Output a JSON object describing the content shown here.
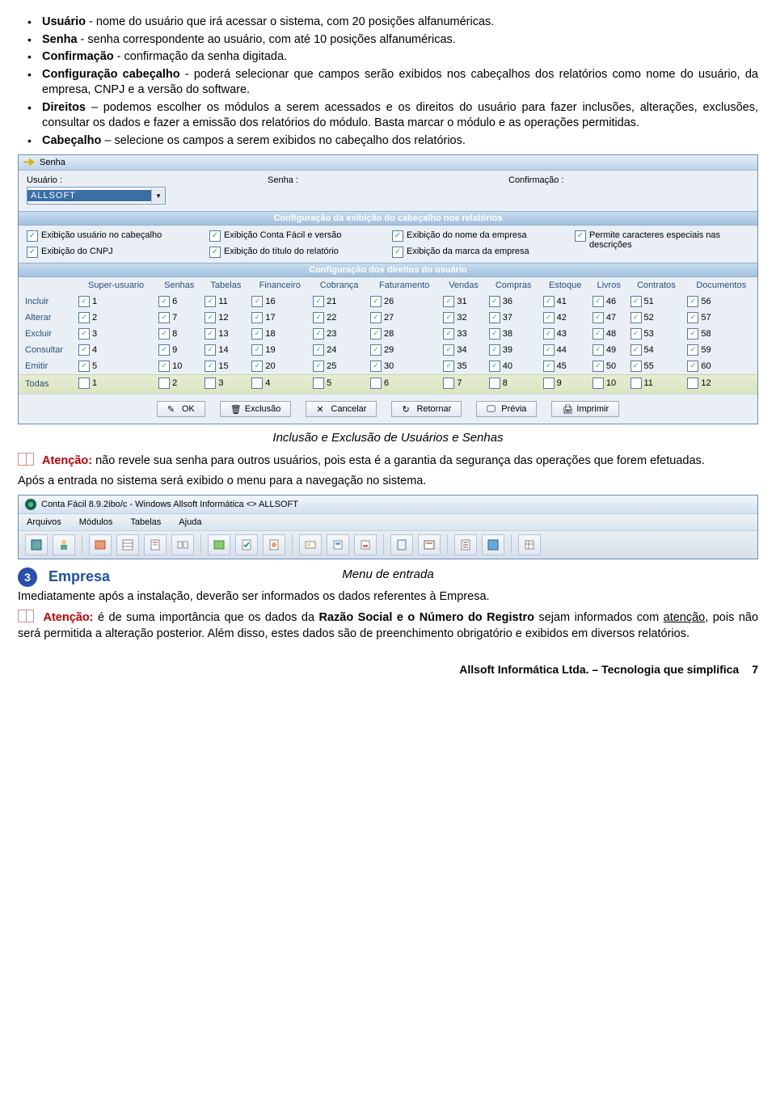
{
  "bullets": [
    {
      "lead": "Usuário",
      "rest": " - nome do usuário que irá acessar o sistema, com 20 posições alfanuméricas."
    },
    {
      "lead": "Senha",
      "rest": " - senha correspondente ao usuário, com até 10 posições alfanuméricas."
    },
    {
      "lead": "Confirmação",
      "rest": " - confirmação da senha digitada."
    },
    {
      "lead": "Configuração cabeçalho",
      "rest": "  - poderá selecionar que campos serão exibidos nos cabeçalhos dos relatórios como nome do usuário, da empresa, CNPJ e a versão do software.",
      "wrap": true
    },
    {
      "lead": "Direitos",
      "rest": " – podemos escolher os módulos a serem acessados e os direitos do usuário para fazer inclusões, alterações, exclusões, consultar os dados e fazer a emissão dos relatórios do módulo. Basta marcar o módulo e as operações permitidas.",
      "wrap": true
    },
    {
      "lead": "Cabeçalho",
      "rest": " – selecione os campos a serem exibidos no cabeçalho dos relatórios."
    }
  ],
  "senha": {
    "title": "Senha",
    "labels": {
      "usuario": "Usuário :",
      "senha": "Senha :",
      "conf": "Confirmação :"
    },
    "usuarioValue": "ALLSOFT",
    "band1": "Configuração da exibição do cabeçalho nos relatórios",
    "band2": "Configuração dos direitos do usuário",
    "chk": {
      "c1": "Exibição usuário no cabeçalho",
      "c2": "Exibição do CNPJ",
      "c3": "Exibição Conta Fácil  e versão",
      "c4": "Exibição do título do relatório",
      "c5": "Exibição do nome da empresa",
      "c6": "Exibição da marca da empresa",
      "c7": "Permite caracteres especiais nas descrições"
    },
    "cols": [
      "Super-usuario",
      "Senhas",
      "Tabelas",
      "Financeiro",
      "Cobrança",
      "Faturamento",
      "Vendas",
      "Compras",
      "Estoque",
      "Livros",
      "Contratos",
      "Documentos"
    ],
    "rows": [
      "Incluir",
      "Alterar",
      "Excluir",
      "Consultar",
      "Emitir",
      "Todas"
    ],
    "buttons": {
      "ok": "OK",
      "exc": "Exclusão",
      "canc": "Cancelar",
      "ret": "Retornar",
      "prev": "Prévia",
      "imp": "Imprimir"
    }
  },
  "caption1": "Inclusão e Exclusão de Usuários e Senhas",
  "aten1_lead": "Atenção:",
  "aten1_rest": " não revele sua senha para outros usuários, pois esta é a garantia da segurança das operações que forem efetuadas.",
  "after_login": "Após a entrada no sistema será exibido o menu para a navegação no sistema.",
  "mainwin": {
    "title": "Conta Fácil 8.9.2ibo/c - Windows  Allsoft Informática  <>  ALLSOFT",
    "menus": [
      "Arquivos",
      "Módulos",
      "Tabelas",
      "Ajuda"
    ]
  },
  "caption2": "Menu de entrada",
  "section3": {
    "num": "❸",
    "title": "Empresa"
  },
  "empresa_p1": "Imediatamente após a instalação, deverão ser informados os dados referentes à Empresa.",
  "aten2_lead": "Atenção:",
  "aten2_rest_1": " é de suma importância que os dados da ",
  "aten2_bold": "Razão Social e o Número do Registro",
  "aten2_rest_2": " sejam informados com ",
  "aten2_under": "atenção",
  "aten2_rest_3": ", pois não será permitida a alteração posterior. Além disso, estes dados são de preenchimento obrigatório e exibidos em diversos relatórios.",
  "footer": {
    "company": "Allsoft Informática Ltda. – Tecnologia que simplifica",
    "page": "7"
  }
}
